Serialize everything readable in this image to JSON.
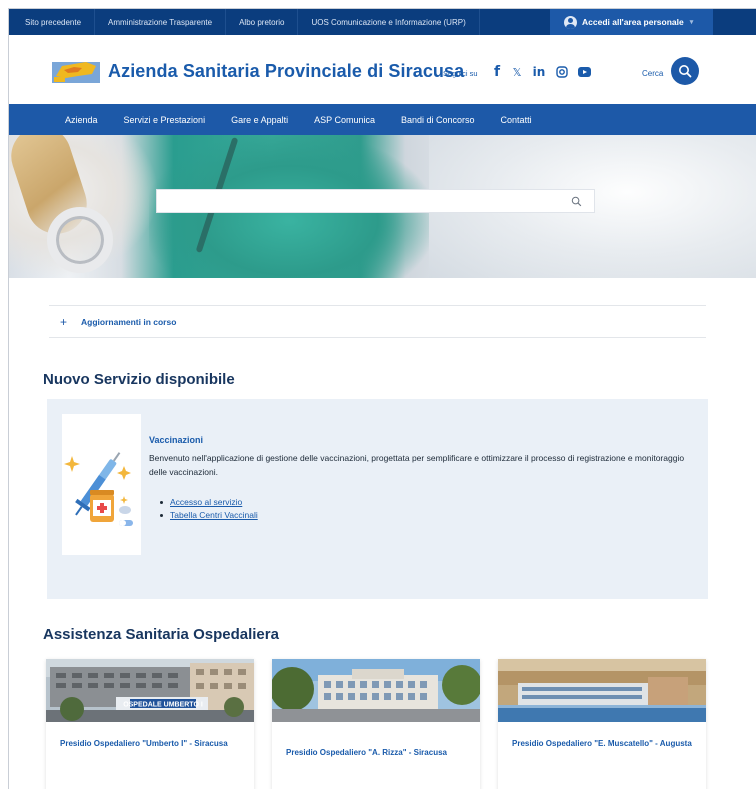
{
  "topbar": {
    "links": [
      "Sito precedente",
      "Amministrazione Trasparente",
      "Albo pretorio",
      "UOS Comunicazione e Informazione (URP)"
    ],
    "login_label": "Accedi all'area personale"
  },
  "header": {
    "title": "Azienda Sanitaria Provinciale di Siracusa",
    "follow_label": "Seguici su",
    "social": [
      "facebook-icon",
      "x-icon",
      "linkedin-icon",
      "instagram-icon",
      "youtube-icon"
    ],
    "search_label": "Cerca"
  },
  "nav": {
    "items": [
      "Azienda",
      "Servizi e Prestazioni",
      "Gare e Appalti",
      "ASP Comunica",
      "Bandi di Concorso",
      "Contatti"
    ]
  },
  "hero": {
    "search_placeholder": ""
  },
  "accordion": {
    "label": "Aggiornamenti in corso"
  },
  "new_service": {
    "heading": "Nuovo Servizio disponibile",
    "title": "Vaccinazioni",
    "description": "Benvenuto nell'applicazione di gestione delle vaccinazioni, progettata per semplificare e ottimizzare il processo di registrazione e monitoraggio delle vaccinazioni.",
    "links": [
      "Accesso al servizio",
      "Tabella Centri Vaccinali"
    ]
  },
  "hospitals": {
    "heading": "Assistenza Sanitaria Ospedaliera",
    "cards": [
      {
        "title": "Presidio Ospedaliero \"Umberto I\" - Siracusa",
        "sign": "OSPEDALE UMBERTO I"
      },
      {
        "title": "Presidio Ospedaliero \"A. Rizza\" - Siracusa"
      },
      {
        "title": "Presidio Ospedaliero \"E. Muscatello\" - Augusta"
      }
    ]
  },
  "colors": {
    "topbar": "#0b3d7e",
    "primary": "#1d59a8",
    "title": "#1a5bab",
    "heading": "#18365f",
    "service_bg": "#eaf0f7"
  }
}
